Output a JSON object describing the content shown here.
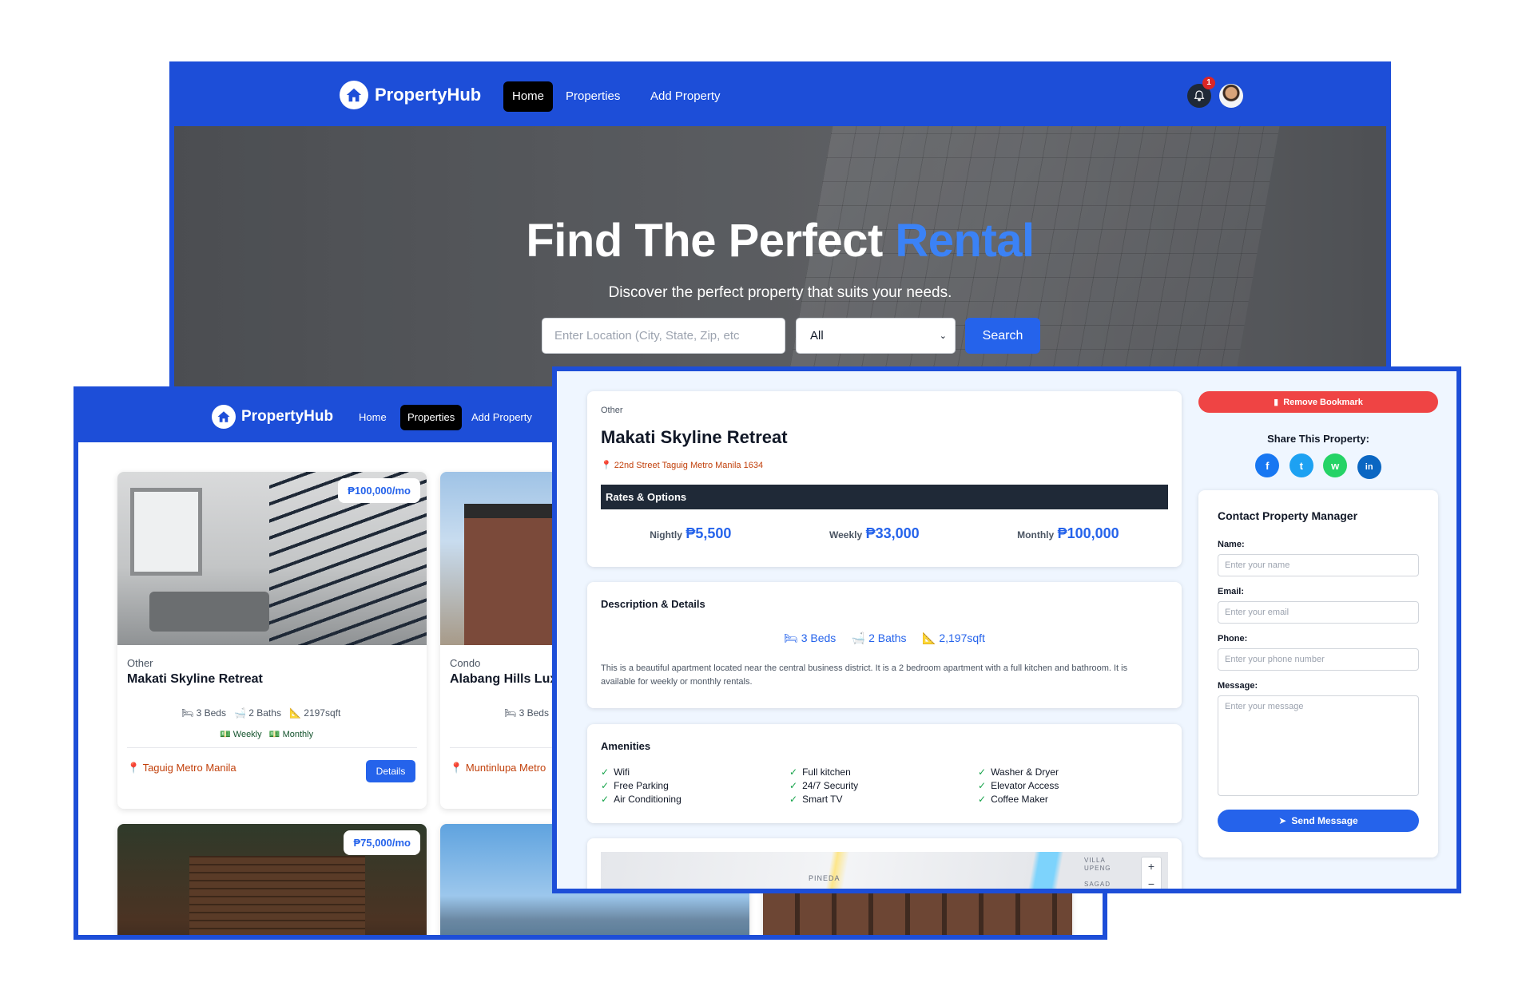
{
  "brand": "PropertyHub",
  "nav": {
    "home": "Home",
    "properties": "Properties",
    "add": "Add Property"
  },
  "notifications": {
    "count": "1"
  },
  "hero": {
    "title_main": "Find The Perfect ",
    "title_accent": "Rental",
    "subtitle": "Discover the perfect property that suits your needs.",
    "location_placeholder": "Enter Location (City, State, Zip, etc",
    "type_select": "All",
    "search": "Search"
  },
  "listings": [
    {
      "price": "₱100,000/mo",
      "type": "Other",
      "name": "Makati Skyline Retreat",
      "beds": "3 Beds",
      "baths": "2 Baths",
      "sqft": "2197sqft",
      "rate1": "Weekly",
      "rate2": "Monthly",
      "location": "Taguig Metro Manila",
      "details": "Details"
    },
    {
      "type": "Condo",
      "name": "Alabang Hills Lux",
      "beds": "3 Beds",
      "location": "Muntinlupa Metro"
    },
    {
      "price": "₱75,000/mo"
    }
  ],
  "detail": {
    "type": "Other",
    "name": "Makati Skyline Retreat",
    "address": "22nd Street Taguig Metro Manila 1634",
    "rates_header": "Rates & Options",
    "rates": [
      {
        "label": "Nightly",
        "value": "₱5,500"
      },
      {
        "label": "Weekly",
        "value": "₱33,000"
      },
      {
        "label": "Monthly",
        "value": "₱100,000"
      }
    ],
    "desc_title": "Description & Details",
    "beds": "3 Beds",
    "baths": "2 Baths",
    "sqft": "2,197sqft",
    "description": "This is a beautiful apartment located near the central business district. It is a 2 bedroom apartment with a full kitchen and bathroom. It is available for weekly or monthly rentals.",
    "amenities_title": "Amenities",
    "amenities": [
      [
        "Wifi",
        "Free Parking",
        "Air Conditioning"
      ],
      [
        "Full kitchen",
        "24/7 Security",
        "Smart TV"
      ],
      [
        "Washer & Dryer",
        "Elevator Access",
        "Coffee Maker"
      ]
    ],
    "map_labels": [
      "PINEDA",
      "VILLA UPENG",
      "SAGAD"
    ]
  },
  "sidebar": {
    "bookmark": "Remove Bookmark",
    "share": "Share This Property:",
    "social": [
      "f",
      "t",
      "w",
      "in"
    ],
    "contact_title": "Contact Property Manager",
    "name_label": "Name:",
    "name_ph": "Enter your name",
    "email_label": "Email:",
    "email_ph": "Enter your email",
    "phone_label": "Phone:",
    "phone_ph": "Enter your phone number",
    "msg_label": "Message:",
    "msg_ph": "Enter your message",
    "send": "Send Message"
  },
  "colors": {
    "primary": "#1d4ed8",
    "accent": "#3b82f6",
    "danger": "#ef4444",
    "location": "#c2410c"
  }
}
